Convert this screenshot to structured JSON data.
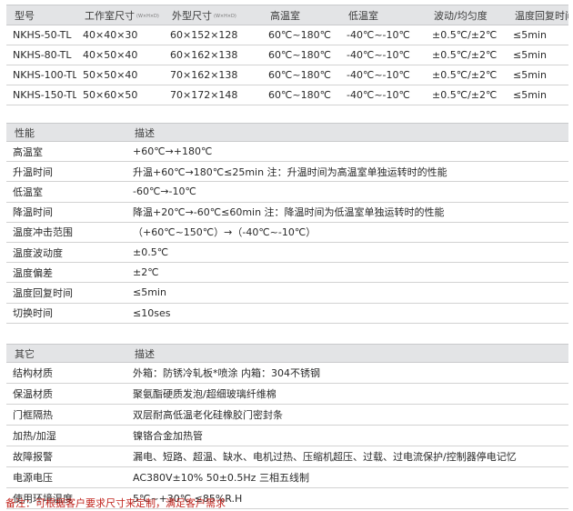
{
  "models": {
    "headers": [
      "型号",
      "工作室尺寸",
      "外型尺寸",
      "高温室",
      "低温室",
      "波动/均匀度",
      "温度回复时间"
    ],
    "header_subs": [
      "",
      "(W×H×D)",
      "(W×H×D)",
      "",
      "",
      "",
      ""
    ],
    "rows": [
      [
        "NKHS-50-TL",
        "40×40×30",
        "60×152×128",
        "60℃~180℃",
        "-40℃~-10℃",
        "±0.5℃/±2℃",
        "≤5min"
      ],
      [
        "NKHS-80-TL",
        "40×50×40",
        "60×162×138",
        "60℃~180℃",
        "-40℃~-10℃",
        "±0.5℃/±2℃",
        "≤5min"
      ],
      [
        "NKHS-100-TL",
        "50×50×40",
        "70×162×138",
        "60℃~180℃",
        "-40℃~-10℃",
        "±0.5℃/±2℃",
        "≤5min"
      ],
      [
        "NKHS-150-TL",
        "50×60×50",
        "70×172×148",
        "60℃~180℃",
        "-40℃~-10℃",
        "±0.5℃/±2℃",
        "≤5min"
      ]
    ]
  },
  "performance": {
    "headers": [
      "性能",
      "描述"
    ],
    "rows": [
      [
        "高温室",
        "+60℃→+180℃"
      ],
      [
        "升温时间",
        "升温+60℃→180℃≤25min 注：升温时间为高温室单独运转时的性能"
      ],
      [
        "低温室",
        "-60℃→-10℃"
      ],
      [
        "降温时间",
        "降温+20℃→-60℃≤60min 注：降温时间为低温室单独运转时的性能"
      ],
      [
        "温度冲击范围",
        "（+60℃~150℃）→（-40℃~-10℃）"
      ],
      [
        "温度波动度",
        "±0.5℃"
      ],
      [
        "温度偏差",
        "±2℃"
      ],
      [
        "温度回复时间",
        "≤5min"
      ],
      [
        "切换时间",
        "≤10ses"
      ]
    ]
  },
  "other": {
    "headers": [
      "其它",
      "描述"
    ],
    "rows": [
      [
        "结构材质",
        "外箱：防锈冷轧板*喷涂   内箱：304不锈钢"
      ],
      [
        "保温材质",
        "聚氨酯硬质发泡/超细玻璃纤维棉"
      ],
      [
        "门框隔热",
        "双层耐高低温老化硅橡胶门密封条"
      ],
      [
        "加热/加湿",
        "镍铬合金加热管"
      ],
      [
        "故障报警",
        "漏电、短路、超温、缺水、电机过热、压缩机超压、过载、过电流保护/控制器停电记忆"
      ],
      [
        "电源电压",
        "AC380V±10% 50±0.5Hz 三相五线制"
      ],
      [
        "使用环境温度",
        "5℃~+30℃ ≤85%R.H"
      ]
    ]
  },
  "note": "备注：可根据客户要求尺寸来定制，满足客户需求"
}
